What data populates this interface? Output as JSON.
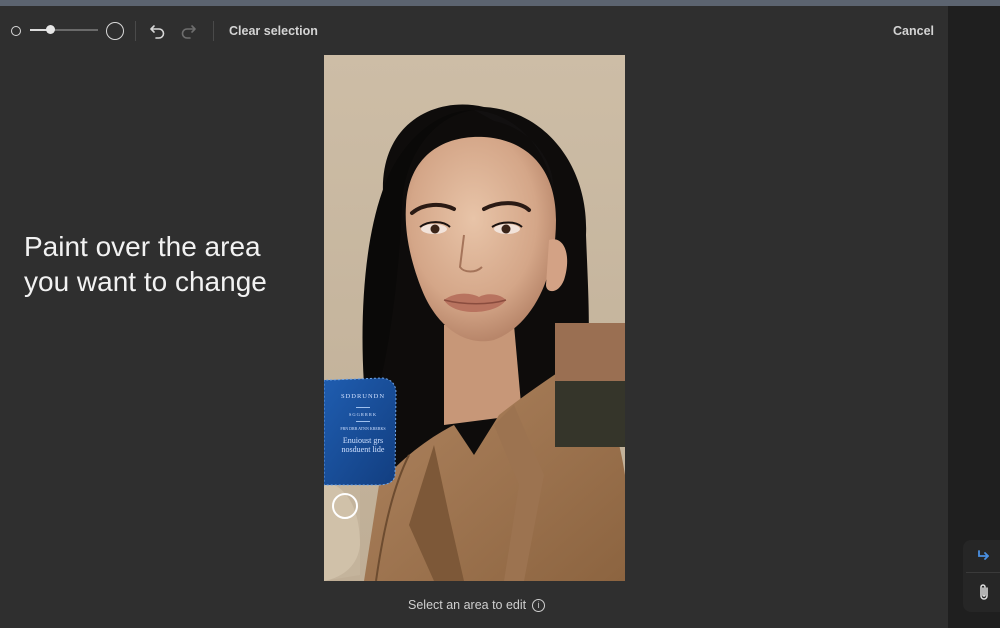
{
  "toolbar": {
    "brush_size_small_icon": "circle-small-icon",
    "brush_size_value": 0.3,
    "brush_size_large_icon": "circle-large-icon",
    "undo_icon": "undo-icon",
    "redo_icon": "redo-icon",
    "clear_selection_label": "Clear selection",
    "cancel_label": "Cancel"
  },
  "instruction": {
    "line1": "Paint over the area",
    "line2": "you want to change"
  },
  "canvas": {
    "subject": "portrait-image",
    "label_card": {
      "line1": "SDDRUNDN",
      "line2": "SGGRRRK",
      "line3": "FRN DRR ATNN KRERKS",
      "line4": "Enuioust grs",
      "line5": "nosduent lide"
    }
  },
  "hint": {
    "text": "Select an area to edit",
    "info_icon": "info-icon"
  },
  "side": {
    "send_icon": "arrow-return-icon",
    "attach_icon": "paperclip-icon"
  },
  "colors": {
    "background": "#2f2f2f",
    "canvas_bg": "#c9b8a0",
    "accent_blue": "#4a90e2"
  }
}
